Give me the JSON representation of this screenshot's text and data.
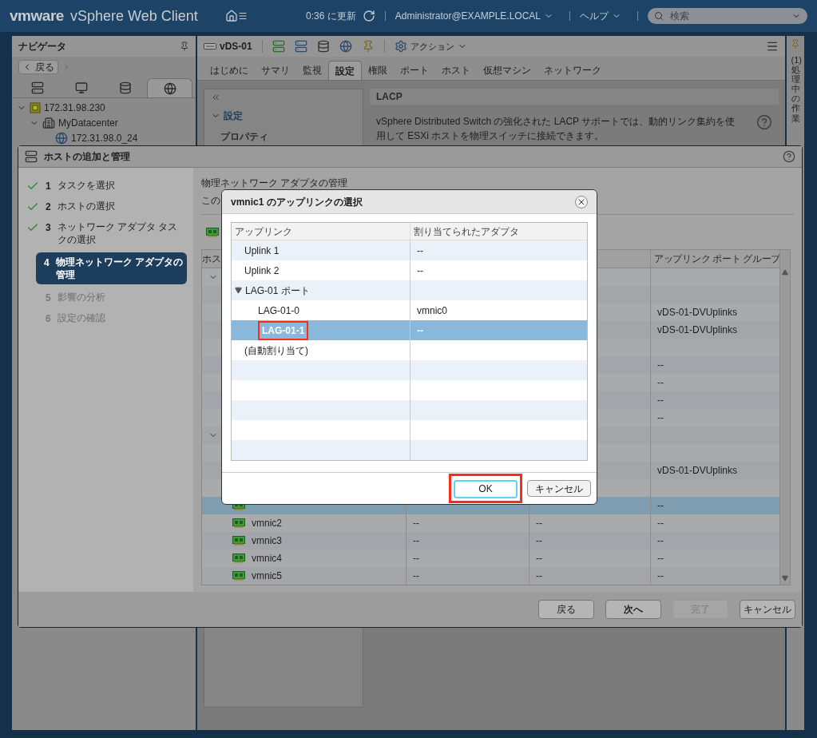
{
  "header": {
    "brand": "vmware",
    "product": "vSphere Web Client",
    "updated": "0:36 に更新",
    "user": "Administrator@EXAMPLE.LOCAL",
    "help": "ヘルプ",
    "search": {
      "placeholder": "検索"
    }
  },
  "navigator": {
    "title": "ナビゲータ",
    "back": "戻る",
    "tabs": [
      {
        "kind": "hosts",
        "selected": false
      },
      {
        "kind": "vms",
        "selected": false
      },
      {
        "kind": "storage",
        "selected": false
      },
      {
        "kind": "network",
        "selected": true
      }
    ],
    "tree": [
      {
        "label": "172.31.98.230",
        "kind": "vcenter",
        "expanded": true,
        "children": [
          {
            "label": "MyDatacenter",
            "kind": "datacenter",
            "expanded": true,
            "children": [
              {
                "label": "172.31.98.0_24",
                "kind": "network"
              }
            ]
          }
        ]
      }
    ]
  },
  "object": {
    "name": "vDS-01",
    "actions": "アクション"
  },
  "tabs": [
    {
      "label": "はじめに",
      "selected": false
    },
    {
      "label": "サマリ",
      "selected": false
    },
    {
      "label": "監視",
      "selected": false
    },
    {
      "label": "設定",
      "selected": true
    },
    {
      "label": "権限",
      "selected": false
    },
    {
      "label": "ポート",
      "selected": false
    },
    {
      "label": "ホスト",
      "selected": false
    },
    {
      "label": "仮想マシン",
      "selected": false
    },
    {
      "label": "ネットワーク",
      "selected": false
    }
  ],
  "subnav": {
    "section": "設定",
    "expanded": true,
    "item": "プロパティ"
  },
  "lacp": {
    "title": "LACP",
    "description": "vSphere Distributed Switch の強化された LACP サポートでは、動的リンク集約を使用して ESXi ホストを物理スイッチに接続できます。"
  },
  "tasks_strip": {
    "label": "(1) 処理中の作業"
  },
  "wizard": {
    "title": "ホストの追加と管理",
    "steps": [
      {
        "number": "1",
        "label": "タスクを選択",
        "checked": true,
        "selected": false,
        "disabled": false
      },
      {
        "number": "2",
        "label": "ホストの選択",
        "checked": true,
        "selected": false,
        "disabled": false
      },
      {
        "number": "3",
        "label": "ネットワーク アダプタ タスクの選択",
        "checked": true,
        "selected": false,
        "disabled": false
      },
      {
        "number": "4",
        "label": "物理ネットワーク アダプタの管理",
        "checked": false,
        "selected": true,
        "disabled": false
      },
      {
        "number": "5",
        "label": "影響の分析",
        "checked": false,
        "selected": false,
        "disabled": true
      },
      {
        "number": "6",
        "label": "設定の確認",
        "checked": false,
        "selected": false,
        "disabled": true
      }
    ],
    "page_title": "物理ネットワーク アダプタの管理",
    "page_intro": "この",
    "table": {
      "column_1": "ホス",
      "column_4": "アップリンク ポート グループ",
      "rows": [
        {
          "kind": "group",
          "selected": false
        },
        {
          "kind": "blank",
          "selected": false
        },
        {
          "kind": "blank",
          "group": "vDS-01-DVUplinks",
          "selected": false
        },
        {
          "kind": "blank",
          "group": "vDS-01-DVUplinks",
          "selected": false
        },
        {
          "kind": "blank",
          "selected": false
        },
        {
          "kind": "blank",
          "group": "--",
          "selected": false
        },
        {
          "kind": "blank",
          "group": "--",
          "selected": false
        },
        {
          "kind": "blank",
          "group": "--",
          "selected": false
        },
        {
          "kind": "blank",
          "group": "--",
          "selected": false
        },
        {
          "kind": "group",
          "selected": false
        },
        {
          "kind": "blank",
          "selected": false
        },
        {
          "kind": "blank",
          "group": "vDS-01-DVUplinks",
          "selected": false
        },
        {
          "kind": "blank",
          "selected": false
        },
        {
          "kind": "adapter",
          "group": "--",
          "selected": true
        },
        {
          "kind": "adapter",
          "name": "vmnic2",
          "column_2": "--",
          "column_3": "--",
          "group": "--",
          "selected": false
        },
        {
          "kind": "adapter",
          "name": "vmnic3",
          "column_2": "--",
          "column_3": "--",
          "group": "--",
          "selected": false
        },
        {
          "kind": "adapter",
          "name": "vmnic4",
          "column_2": "--",
          "column_3": "--",
          "group": "--",
          "selected": false
        },
        {
          "kind": "adapter",
          "name": "vmnic5",
          "column_2": "--",
          "column_3": "--",
          "group": "--",
          "selected": false
        }
      ]
    },
    "buttons": [
      {
        "label": "戻る",
        "primary": false,
        "disabled": false
      },
      {
        "label": "次へ",
        "primary": true,
        "disabled": false
      },
      {
        "label": "完了",
        "primary": false,
        "disabled": true
      },
      {
        "label": "キャンセル",
        "primary": false,
        "disabled": false
      }
    ]
  },
  "modal": {
    "title": "vmnic1 のアップリンクの選択",
    "columns": [
      "アップリンク",
      "割り当てられたアダプタ"
    ],
    "rows": [
      {
        "uplink": "Uplink 1",
        "adapter": "--",
        "selected": false,
        "highlighted": false
      },
      {
        "uplink": "Uplink 2",
        "adapter": "--",
        "selected": false,
        "highlighted": false
      },
      {
        "uplink": "LAG-01 ポート",
        "expanded": true,
        "selected": false,
        "highlighted": false,
        "children": [
          {
            "uplink": "LAG-01-0",
            "adapter": "vmnic0",
            "selected": false,
            "highlighted": false
          },
          {
            "uplink": "LAG-01-1",
            "adapter": "--",
            "selected": true,
            "highlighted": true
          }
        ]
      },
      {
        "uplink": "(自動割り当て)",
        "selected": false,
        "highlighted": false
      }
    ],
    "ok": {
      "label": "OK",
      "focused": true,
      "highlighted": true
    },
    "cancel": "キャンセル"
  }
}
